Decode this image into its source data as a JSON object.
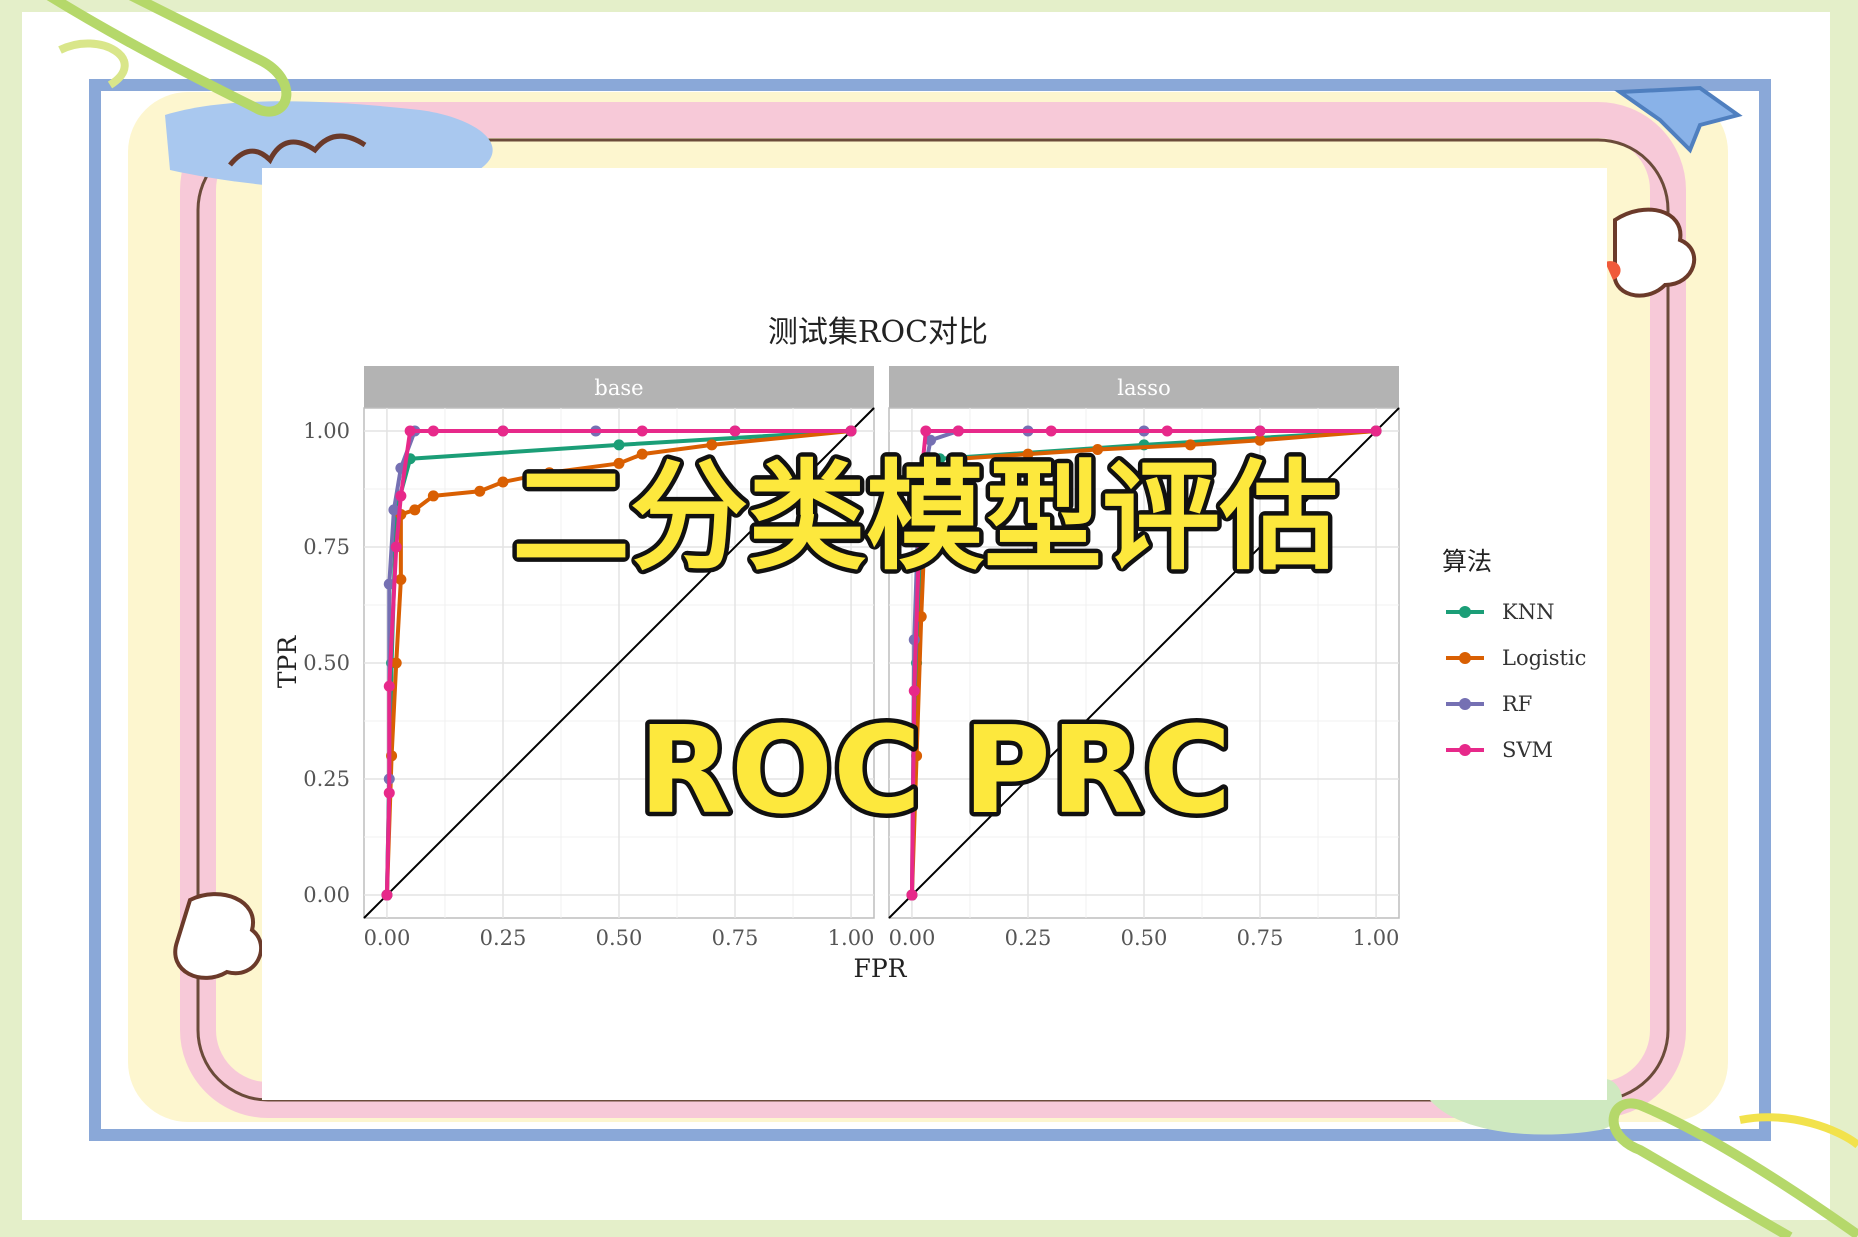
{
  "overlay": {
    "headline": "二分类模型评估",
    "subtitle": "ROC PRC"
  },
  "colors": {
    "KNN": "#1b9e77",
    "Logistic": "#d95f02",
    "RF": "#7570b3",
    "SVM": "#e7298a",
    "overlay_fill": "#fde83d",
    "strip": "#b3b3b3"
  },
  "chart_data": {
    "type": "line",
    "title": "测试集ROC对比",
    "xlabel": "FPR",
    "ylabel": "TPR",
    "xlim": [
      0,
      1
    ],
    "ylim": [
      0,
      1
    ],
    "xticks": [
      "0.00",
      "0.25",
      "0.50",
      "0.75",
      "1.00"
    ],
    "yticks": [
      "0.00",
      "0.25",
      "0.50",
      "0.75",
      "1.00"
    ],
    "grid": true,
    "reference_line": "diagonal",
    "legend": {
      "title": "算法",
      "position": "right",
      "entries": [
        "KNN",
        "Logistic",
        "RF",
        "SVM"
      ]
    },
    "facets": [
      {
        "label": "base",
        "series": [
          {
            "name": "KNN",
            "points": [
              [
                0,
                0
              ],
              [
                0.01,
                0.5
              ],
              [
                0.02,
                0.83
              ],
              [
                0.05,
                0.94
              ],
              [
                0.5,
                0.97
              ],
              [
                1,
                1
              ]
            ]
          },
          {
            "name": "Logistic",
            "points": [
              [
                0,
                0
              ],
              [
                0.01,
                0.3
              ],
              [
                0.02,
                0.5
              ],
              [
                0.03,
                0.68
              ],
              [
                0.03,
                0.82
              ],
              [
                0.06,
                0.83
              ],
              [
                0.1,
                0.86
              ],
              [
                0.2,
                0.87
              ],
              [
                0.25,
                0.89
              ],
              [
                0.35,
                0.91
              ],
              [
                0.5,
                0.93
              ],
              [
                0.55,
                0.95
              ],
              [
                0.7,
                0.97
              ],
              [
                1,
                1
              ]
            ]
          },
          {
            "name": "RF",
            "points": [
              [
                0,
                0
              ],
              [
                0.005,
                0.25
              ],
              [
                0.005,
                0.67
              ],
              [
                0.015,
                0.83
              ],
              [
                0.03,
                0.92
              ],
              [
                0.06,
                1
              ],
              [
                0.25,
                1
              ],
              [
                0.45,
                1
              ],
              [
                0.75,
                1
              ],
              [
                1,
                1
              ]
            ]
          },
          {
            "name": "SVM",
            "points": [
              [
                0,
                0
              ],
              [
                0.005,
                0.22
              ],
              [
                0.005,
                0.45
              ],
              [
                0.02,
                0.75
              ],
              [
                0.03,
                0.86
              ],
              [
                0.05,
                1
              ],
              [
                0.1,
                1
              ],
              [
                0.25,
                1
              ],
              [
                0.55,
                1
              ],
              [
                0.75,
                1
              ],
              [
                1,
                1
              ]
            ]
          }
        ]
      },
      {
        "label": "lasso",
        "series": [
          {
            "name": "KNN",
            "points": [
              [
                0,
                0
              ],
              [
                0.01,
                0.5
              ],
              [
                0.03,
                0.84
              ],
              [
                0.06,
                0.94
              ],
              [
                0.5,
                0.97
              ],
              [
                1,
                1
              ]
            ]
          },
          {
            "name": "Logistic",
            "points": [
              [
                0,
                0
              ],
              [
                0.01,
                0.3
              ],
              [
                0.02,
                0.6
              ],
              [
                0.03,
                0.84
              ],
              [
                0.05,
                0.9
              ],
              [
                0.1,
                0.94
              ],
              [
                0.25,
                0.95
              ],
              [
                0.4,
                0.96
              ],
              [
                0.6,
                0.97
              ],
              [
                0.75,
                0.98
              ],
              [
                1,
                1
              ]
            ]
          },
          {
            "name": "RF",
            "points": [
              [
                0,
                0
              ],
              [
                0.005,
                0.55
              ],
              [
                0.015,
                0.85
              ],
              [
                0.04,
                0.98
              ],
              [
                0.1,
                1
              ],
              [
                0.25,
                1
              ],
              [
                0.5,
                1
              ],
              [
                0.75,
                1
              ],
              [
                1,
                1
              ]
            ]
          },
          {
            "name": "SVM",
            "points": [
              [
                0,
                0
              ],
              [
                0.005,
                0.44
              ],
              [
                0.02,
                0.9
              ],
              [
                0.03,
                1
              ],
              [
                0.1,
                1
              ],
              [
                0.3,
                1
              ],
              [
                0.55,
                1
              ],
              [
                0.75,
                1
              ],
              [
                1,
                1
              ]
            ]
          }
        ]
      }
    ]
  }
}
